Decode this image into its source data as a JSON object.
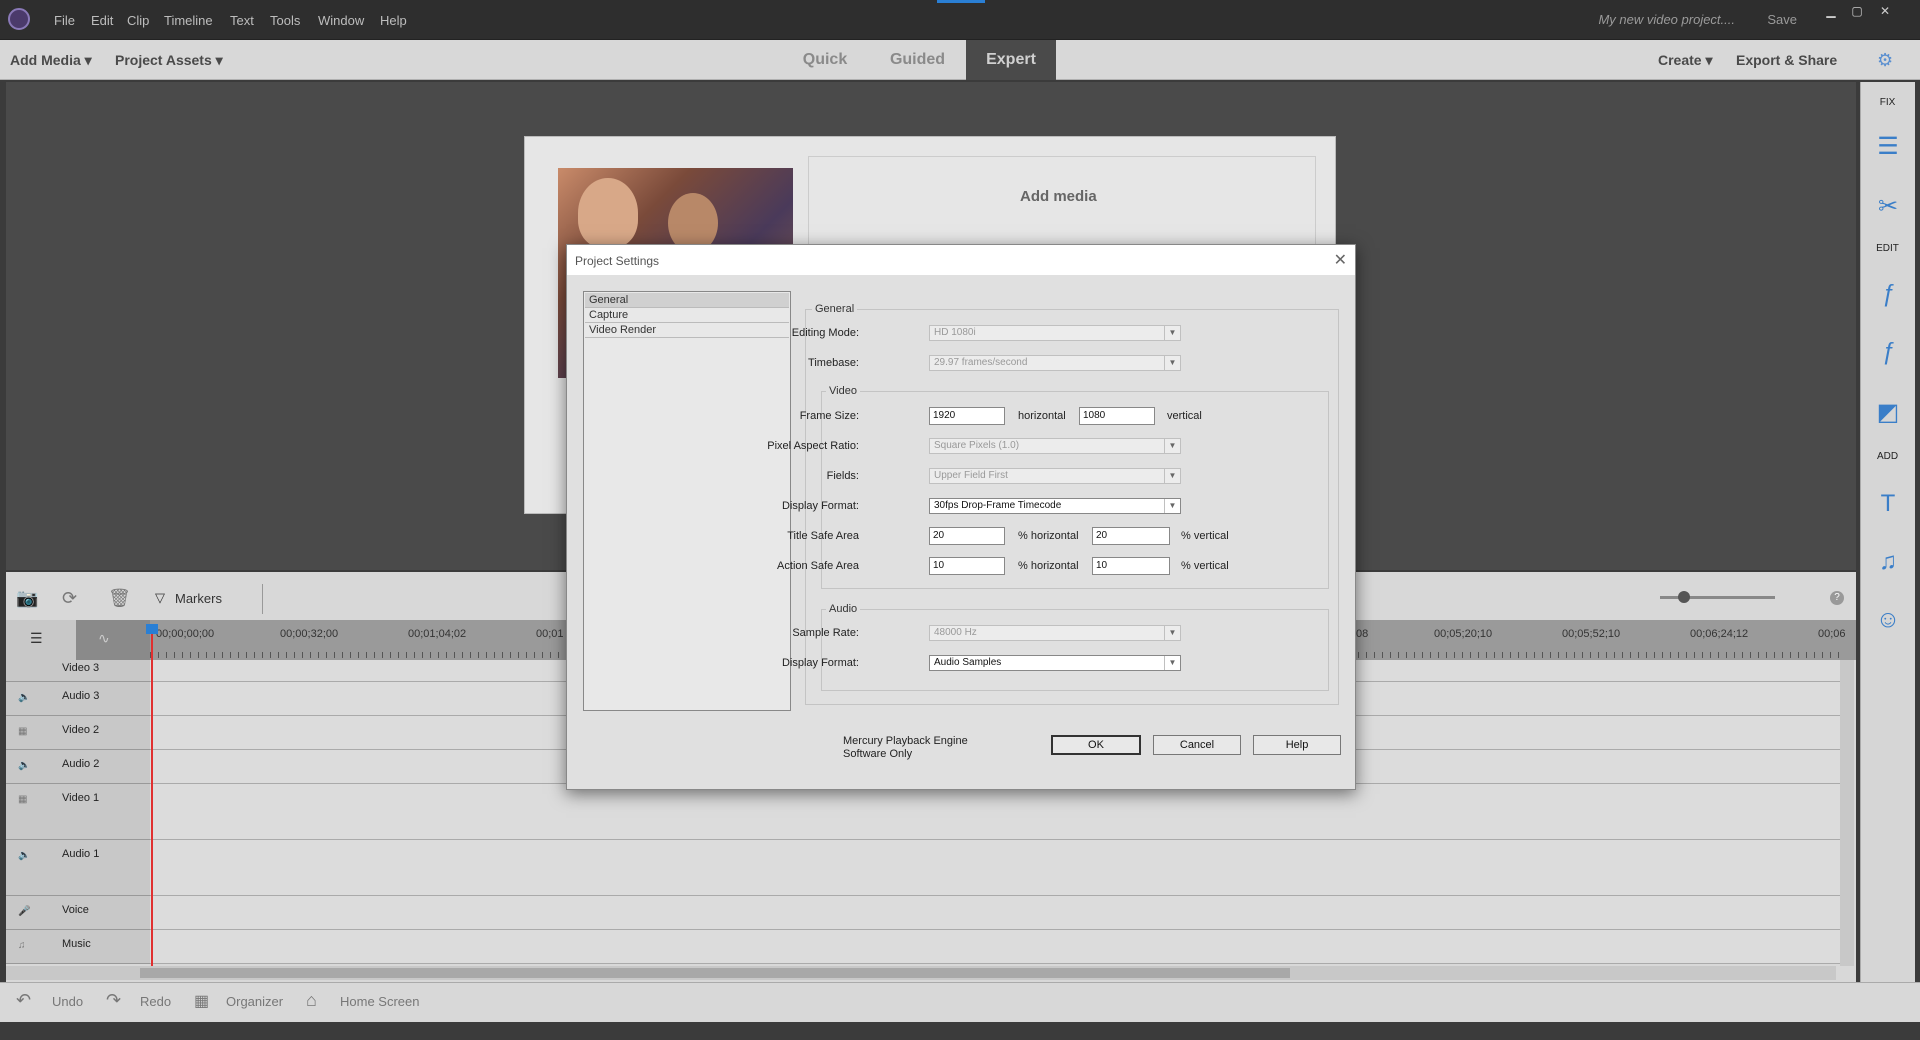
{
  "menu": [
    "File",
    "Edit",
    "Clip",
    "Timeline",
    "Text",
    "Tools",
    "Window",
    "Help"
  ],
  "title": {
    "project_name": "My new video project....",
    "save": "Save"
  },
  "window_controls": {
    "minimize": "▁",
    "maximize": "▢",
    "close": "✕"
  },
  "modebar": {
    "add_media": "Add Media",
    "project_assets": "Project Assets",
    "tabs": [
      "Quick",
      "Guided",
      "Expert"
    ],
    "active_tab": "Expert",
    "create": "Create",
    "export_share": "Export & Share"
  },
  "right_panel": {
    "fix": "FIX",
    "edit": "EDIT",
    "add": "ADD"
  },
  "monitor": {
    "add_media_title": "Add media"
  },
  "timeline": {
    "markers": "Markers",
    "ruler": [
      "00;00;00;00",
      "00;00;32;00",
      "00;01;04;02",
      "00;01",
      "08",
      "00;05;20;10",
      "00;05;52;10",
      "00;06;24;12",
      "00;06"
    ],
    "tracks": [
      {
        "name": "Video 3"
      },
      {
        "name": "Audio 3"
      },
      {
        "name": "Video 2"
      },
      {
        "name": "Audio 2"
      },
      {
        "name": "Video 1"
      },
      {
        "name": "Audio 1"
      },
      {
        "name": "Voice"
      },
      {
        "name": "Music"
      }
    ]
  },
  "bottombar": {
    "undo": "Undo",
    "redo": "Redo",
    "organizer": "Organizer",
    "home": "Home Screen"
  },
  "dialog": {
    "title": "Project Settings",
    "nav": [
      "General",
      "Capture",
      "Video Render"
    ],
    "general": {
      "group_label": "General",
      "editing_mode_label": "Editing Mode:",
      "editing_mode": "HD 1080i",
      "timebase_label": "Timebase:",
      "timebase": "29.97 frames/second"
    },
    "video": {
      "group_label": "Video",
      "frame_size_label": "Frame Size:",
      "frame_w": "1920",
      "horizontal": "horizontal",
      "frame_h": "1080",
      "vertical": "vertical",
      "par_label": "Pixel Aspect Ratio:",
      "par": "Square Pixels (1.0)",
      "fields_label": "Fields:",
      "fields": "Upper Field First",
      "display_format_label": "Display Format:",
      "display_format": "30fps Drop-Frame Timecode",
      "title_safe_label": "Title Safe Area",
      "title_safe_h": "20",
      "title_safe_v": "20",
      "action_safe_label": "Action Safe Area",
      "action_safe_h": "10",
      "action_safe_v": "10",
      "pct_horizontal": "% horizontal",
      "pct_vertical": "% vertical"
    },
    "audio": {
      "group_label": "Audio",
      "sample_rate_label": "Sample Rate:",
      "sample_rate": "48000 Hz",
      "display_format_label": "Display Format:",
      "display_format": "Audio Samples"
    },
    "mercury": "Mercury Playback Engine Software Only",
    "buttons": {
      "ok": "OK",
      "cancel": "Cancel",
      "help": "Help"
    }
  }
}
